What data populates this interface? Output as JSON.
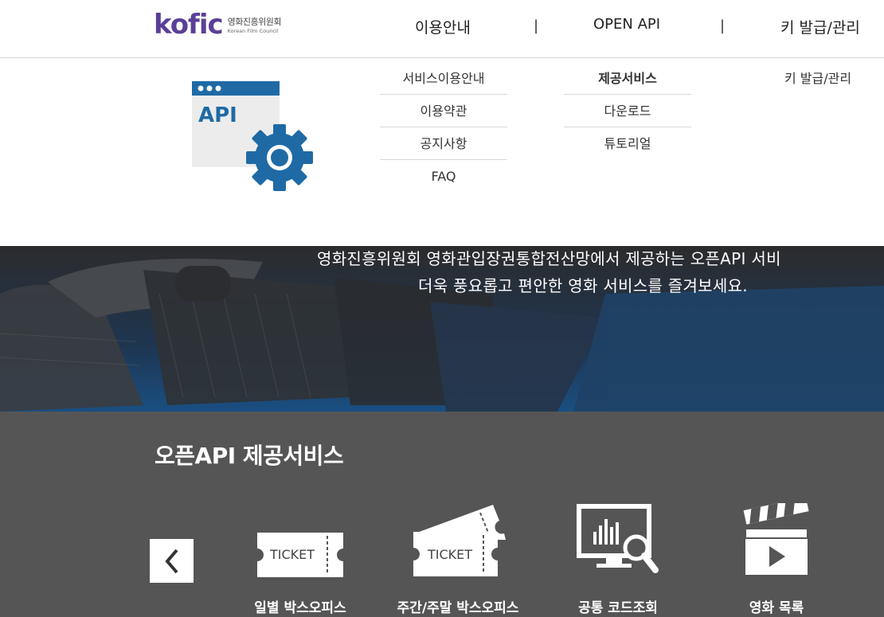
{
  "header": {
    "logo_mark": "kofic",
    "logo_ko": "영화진흥위원회",
    "logo_en": "Korean Film Council",
    "nav": [
      "이용안내",
      "OPEN API",
      "키 발급/관리"
    ],
    "separator": "|"
  },
  "dropdown": {
    "illustration_label": "API",
    "col1": [
      "서비스이용안내",
      "이용약관",
      "공지사항",
      "FAQ"
    ],
    "col2": [
      "제공서비스",
      "다운로드",
      "튜토리얼"
    ],
    "col3": [
      "키 발급/관리"
    ]
  },
  "hero": {
    "line1": "영화진흥위원회 영화관입장권통합전산망에서 제공하는 오픈API 서비",
    "line2": "더욱 풍요롭고 편안한 영화 서비스를 즐겨보세요."
  },
  "services": {
    "title": "오픈API 제공서비스",
    "ticket_text": "TICKET",
    "items": [
      "일별 박스오피스",
      "주간/주말 박스오피스",
      "공통 코드조회",
      "영화 목록"
    ]
  },
  "colors": {
    "brand": "#5b3f97",
    "api_blue": "#1f6aa5",
    "services_bg": "#555556"
  }
}
